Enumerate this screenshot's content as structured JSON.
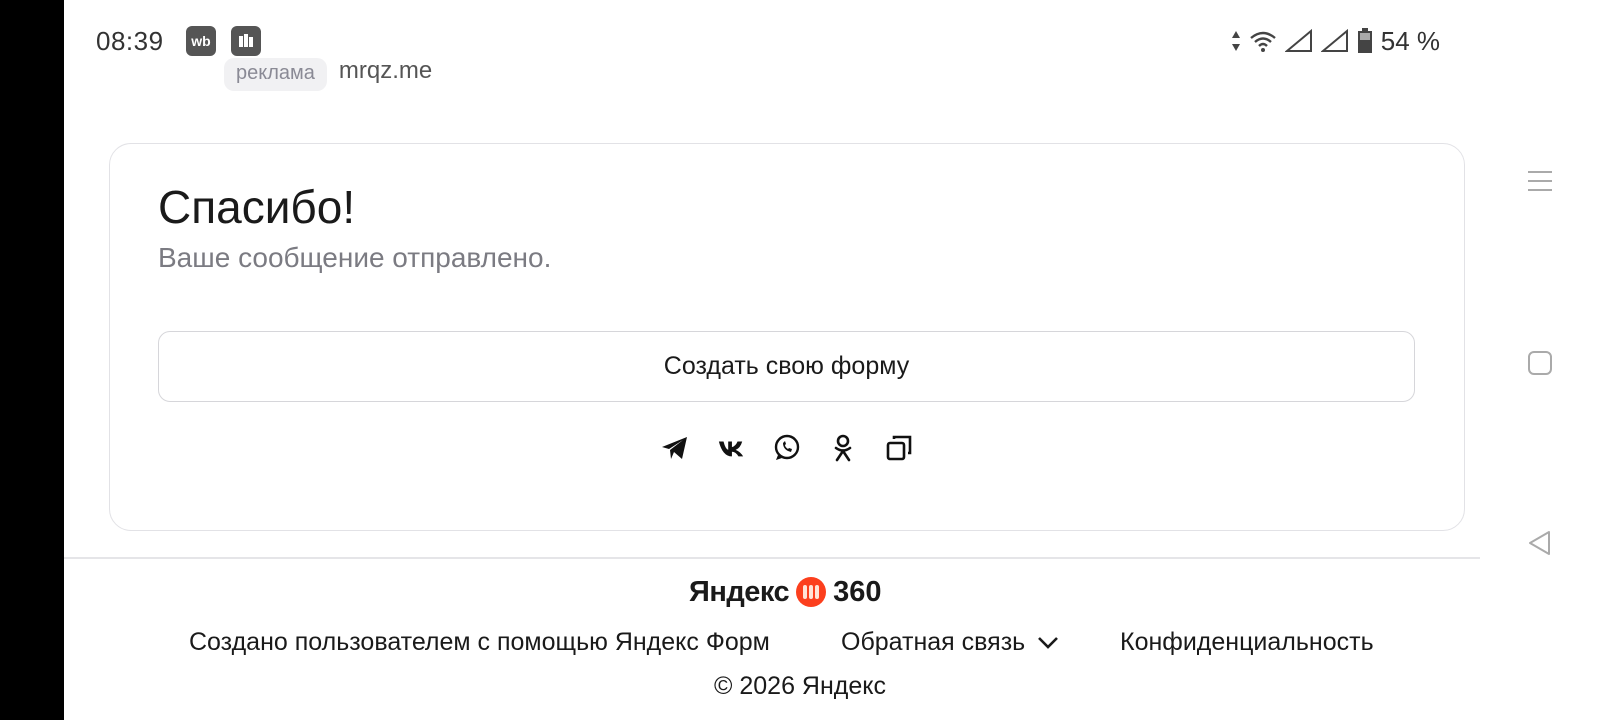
{
  "status_bar": {
    "time": "08:39",
    "app_badges": [
      "wb"
    ],
    "battery": "54 %"
  },
  "ad": {
    "badge": "реклама",
    "domain": "mrqz.me"
  },
  "card": {
    "title": "Спасибо!",
    "subtitle": "Ваше сообщение отправлено.",
    "create_button": "Создать свою форму",
    "share_icons": [
      "telegram-icon",
      "vk-icon",
      "whatsapp-icon",
      "odnoklassniki-icon",
      "copy-icon"
    ]
  },
  "footer": {
    "logo_text": "Яндекс",
    "logo_number": "360",
    "logo_color": "#fc3f1d",
    "created_by": "Создано пользователем с помощью Яндекс Форм",
    "feedback": "Обратная связь",
    "privacy": "Конфиденциальность",
    "copyright": "© 2026 Яндекс"
  }
}
